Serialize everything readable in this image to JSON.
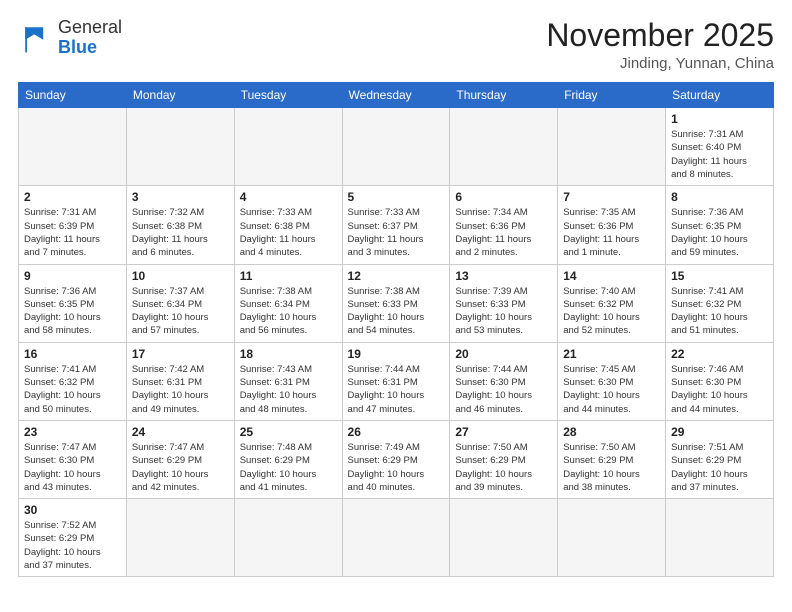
{
  "logo": {
    "line1": "General",
    "line2": "Blue"
  },
  "title": "November 2025",
  "location": "Jinding, Yunnan, China",
  "weekdays": [
    "Sunday",
    "Monday",
    "Tuesday",
    "Wednesday",
    "Thursday",
    "Friday",
    "Saturday"
  ],
  "weeks": [
    [
      {
        "day": "",
        "info": ""
      },
      {
        "day": "",
        "info": ""
      },
      {
        "day": "",
        "info": ""
      },
      {
        "day": "",
        "info": ""
      },
      {
        "day": "",
        "info": ""
      },
      {
        "day": "",
        "info": ""
      },
      {
        "day": "1",
        "info": "Sunrise: 7:31 AM\nSunset: 6:40 PM\nDaylight: 11 hours\nand 8 minutes."
      }
    ],
    [
      {
        "day": "2",
        "info": "Sunrise: 7:31 AM\nSunset: 6:39 PM\nDaylight: 11 hours\nand 7 minutes."
      },
      {
        "day": "3",
        "info": "Sunrise: 7:32 AM\nSunset: 6:38 PM\nDaylight: 11 hours\nand 6 minutes."
      },
      {
        "day": "4",
        "info": "Sunrise: 7:33 AM\nSunset: 6:38 PM\nDaylight: 11 hours\nand 4 minutes."
      },
      {
        "day": "5",
        "info": "Sunrise: 7:33 AM\nSunset: 6:37 PM\nDaylight: 11 hours\nand 3 minutes."
      },
      {
        "day": "6",
        "info": "Sunrise: 7:34 AM\nSunset: 6:36 PM\nDaylight: 11 hours\nand 2 minutes."
      },
      {
        "day": "7",
        "info": "Sunrise: 7:35 AM\nSunset: 6:36 PM\nDaylight: 11 hours\nand 1 minute."
      },
      {
        "day": "8",
        "info": "Sunrise: 7:36 AM\nSunset: 6:35 PM\nDaylight: 10 hours\nand 59 minutes."
      }
    ],
    [
      {
        "day": "9",
        "info": "Sunrise: 7:36 AM\nSunset: 6:35 PM\nDaylight: 10 hours\nand 58 minutes."
      },
      {
        "day": "10",
        "info": "Sunrise: 7:37 AM\nSunset: 6:34 PM\nDaylight: 10 hours\nand 57 minutes."
      },
      {
        "day": "11",
        "info": "Sunrise: 7:38 AM\nSunset: 6:34 PM\nDaylight: 10 hours\nand 56 minutes."
      },
      {
        "day": "12",
        "info": "Sunrise: 7:38 AM\nSunset: 6:33 PM\nDaylight: 10 hours\nand 54 minutes."
      },
      {
        "day": "13",
        "info": "Sunrise: 7:39 AM\nSunset: 6:33 PM\nDaylight: 10 hours\nand 53 minutes."
      },
      {
        "day": "14",
        "info": "Sunrise: 7:40 AM\nSunset: 6:32 PM\nDaylight: 10 hours\nand 52 minutes."
      },
      {
        "day": "15",
        "info": "Sunrise: 7:41 AM\nSunset: 6:32 PM\nDaylight: 10 hours\nand 51 minutes."
      }
    ],
    [
      {
        "day": "16",
        "info": "Sunrise: 7:41 AM\nSunset: 6:32 PM\nDaylight: 10 hours\nand 50 minutes."
      },
      {
        "day": "17",
        "info": "Sunrise: 7:42 AM\nSunset: 6:31 PM\nDaylight: 10 hours\nand 49 minutes."
      },
      {
        "day": "18",
        "info": "Sunrise: 7:43 AM\nSunset: 6:31 PM\nDaylight: 10 hours\nand 48 minutes."
      },
      {
        "day": "19",
        "info": "Sunrise: 7:44 AM\nSunset: 6:31 PM\nDaylight: 10 hours\nand 47 minutes."
      },
      {
        "day": "20",
        "info": "Sunrise: 7:44 AM\nSunset: 6:30 PM\nDaylight: 10 hours\nand 46 minutes."
      },
      {
        "day": "21",
        "info": "Sunrise: 7:45 AM\nSunset: 6:30 PM\nDaylight: 10 hours\nand 44 minutes."
      },
      {
        "day": "22",
        "info": "Sunrise: 7:46 AM\nSunset: 6:30 PM\nDaylight: 10 hours\nand 44 minutes."
      }
    ],
    [
      {
        "day": "23",
        "info": "Sunrise: 7:47 AM\nSunset: 6:30 PM\nDaylight: 10 hours\nand 43 minutes."
      },
      {
        "day": "24",
        "info": "Sunrise: 7:47 AM\nSunset: 6:29 PM\nDaylight: 10 hours\nand 42 minutes."
      },
      {
        "day": "25",
        "info": "Sunrise: 7:48 AM\nSunset: 6:29 PM\nDaylight: 10 hours\nand 41 minutes."
      },
      {
        "day": "26",
        "info": "Sunrise: 7:49 AM\nSunset: 6:29 PM\nDaylight: 10 hours\nand 40 minutes."
      },
      {
        "day": "27",
        "info": "Sunrise: 7:50 AM\nSunset: 6:29 PM\nDaylight: 10 hours\nand 39 minutes."
      },
      {
        "day": "28",
        "info": "Sunrise: 7:50 AM\nSunset: 6:29 PM\nDaylight: 10 hours\nand 38 minutes."
      },
      {
        "day": "29",
        "info": "Sunrise: 7:51 AM\nSunset: 6:29 PM\nDaylight: 10 hours\nand 37 minutes."
      }
    ],
    [
      {
        "day": "30",
        "info": "Sunrise: 7:52 AM\nSunset: 6:29 PM\nDaylight: 10 hours\nand 37 minutes."
      },
      {
        "day": "",
        "info": ""
      },
      {
        "day": "",
        "info": ""
      },
      {
        "day": "",
        "info": ""
      },
      {
        "day": "",
        "info": ""
      },
      {
        "day": "",
        "info": ""
      },
      {
        "day": "",
        "info": ""
      }
    ]
  ],
  "colors": {
    "header_bg": "#2a6ac8",
    "header_text": "#ffffff",
    "border": "#bbbbbb",
    "empty_bg": "#f5f5f5"
  }
}
